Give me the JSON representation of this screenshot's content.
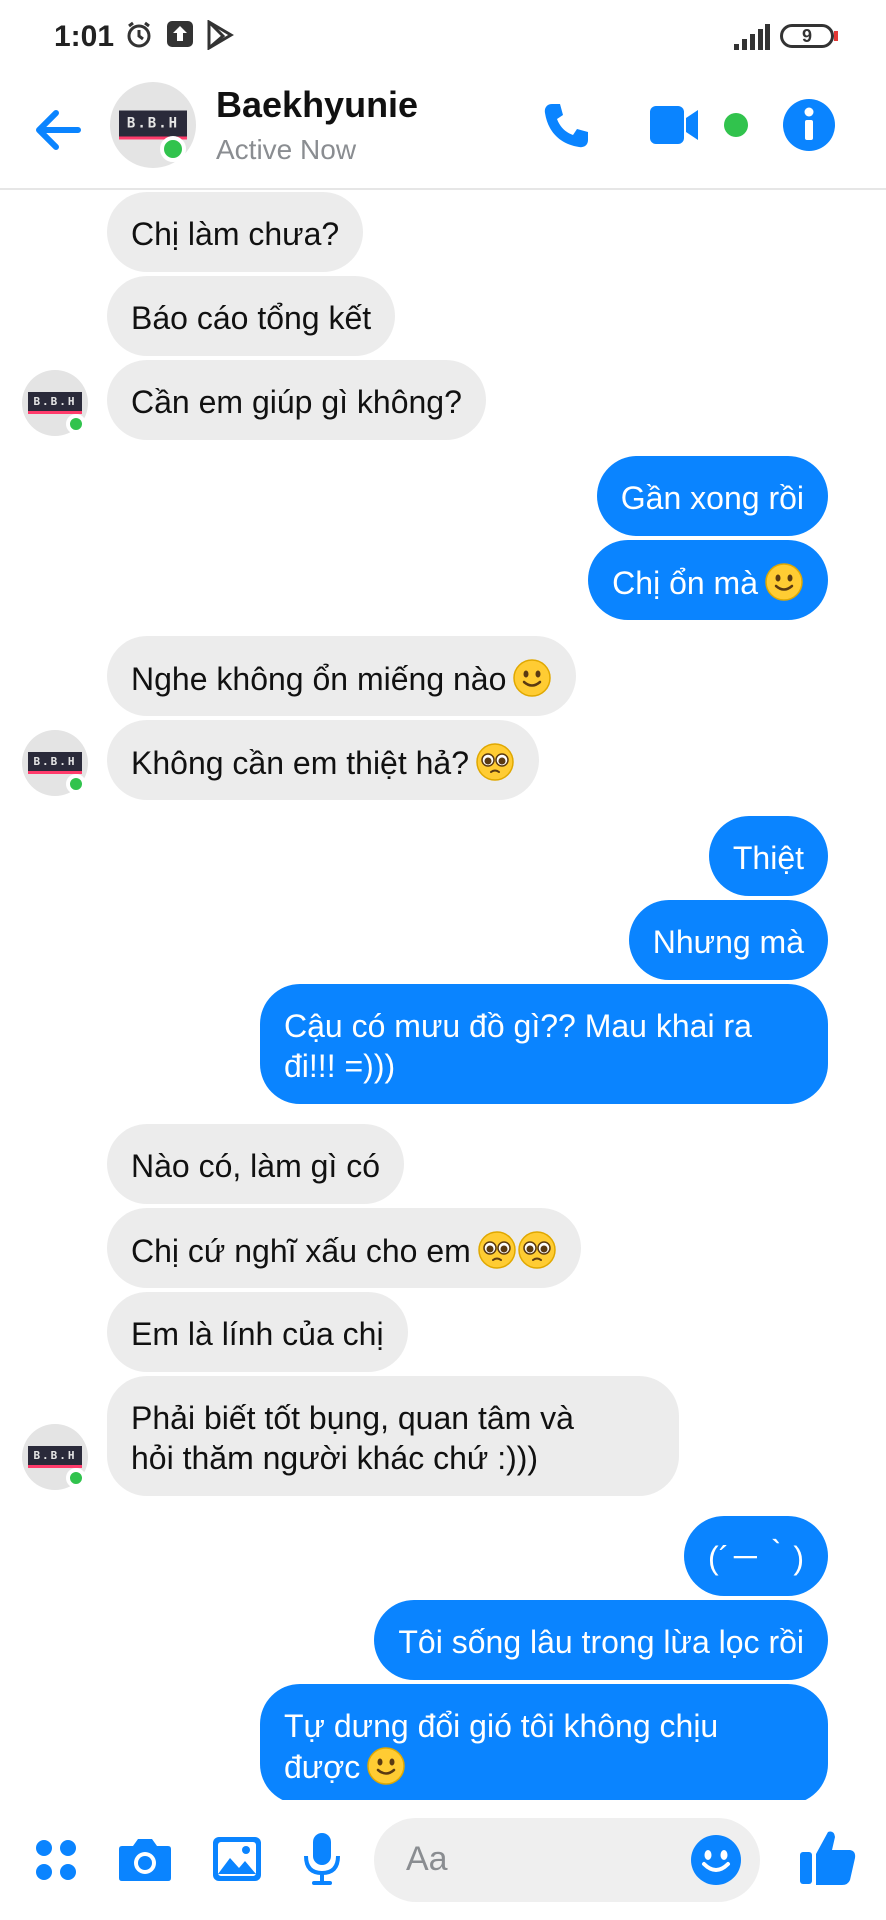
{
  "status_bar": {
    "time": "1:01",
    "battery": "9"
  },
  "header": {
    "contact_name": "Baekhyunie",
    "presence": "Active Now",
    "avatar_logo_text": "B.B.H"
  },
  "messages": [
    {
      "text": "Chị làm chưa?"
    },
    {
      "text": "Báo cáo tổng kết"
    },
    {
      "text": "Cần em giúp gì không?"
    },
    {
      "text": "Gần xong rồi"
    },
    {
      "text": "Chị ổn mà"
    },
    {
      "text": "Nghe không ổn miếng nào"
    },
    {
      "text": "Không cần em thiệt hả?"
    },
    {
      "text": "Thiệt"
    },
    {
      "text": "Nhưng mà"
    },
    {
      "line1": "Cậu có mưu đồ gì?? Mau khai ra",
      "line2": "đi!!! =)))"
    },
    {
      "text": "Nào có, làm gì có"
    },
    {
      "text": "Chị cứ nghĩ xấu cho em"
    },
    {
      "text": "Em là lính của chị"
    },
    {
      "line1": "Phải biết tốt bụng, quan tâm và",
      "line2": "hỏi thăm người khác chứ :)))"
    },
    {
      "text": "(´－｀)"
    },
    {
      "text": "Tôi sống lâu trong lừa lọc rồi"
    },
    {
      "line1": "Tự dưng đổi gió tôi không chịu",
      "line2": "được"
    }
  ],
  "composer": {
    "placeholder": "Aa"
  },
  "icons": {
    "back": "arrow-left-icon",
    "call": "phone-icon",
    "video": "video-icon",
    "info": "info-icon",
    "apps": "grid-dots-icon",
    "camera": "camera-icon",
    "gallery": "image-icon",
    "voice": "microphone-icon",
    "emoji": "smiley-icon",
    "like": "thumbs-up-icon",
    "emoji_smile": "slight-smile-emoji",
    "emoji_pleading": "pleading-face-emoji"
  },
  "colors": {
    "accent": "#0a84ff",
    "incoming_bubble": "#ececec",
    "online": "#31c34d"
  }
}
